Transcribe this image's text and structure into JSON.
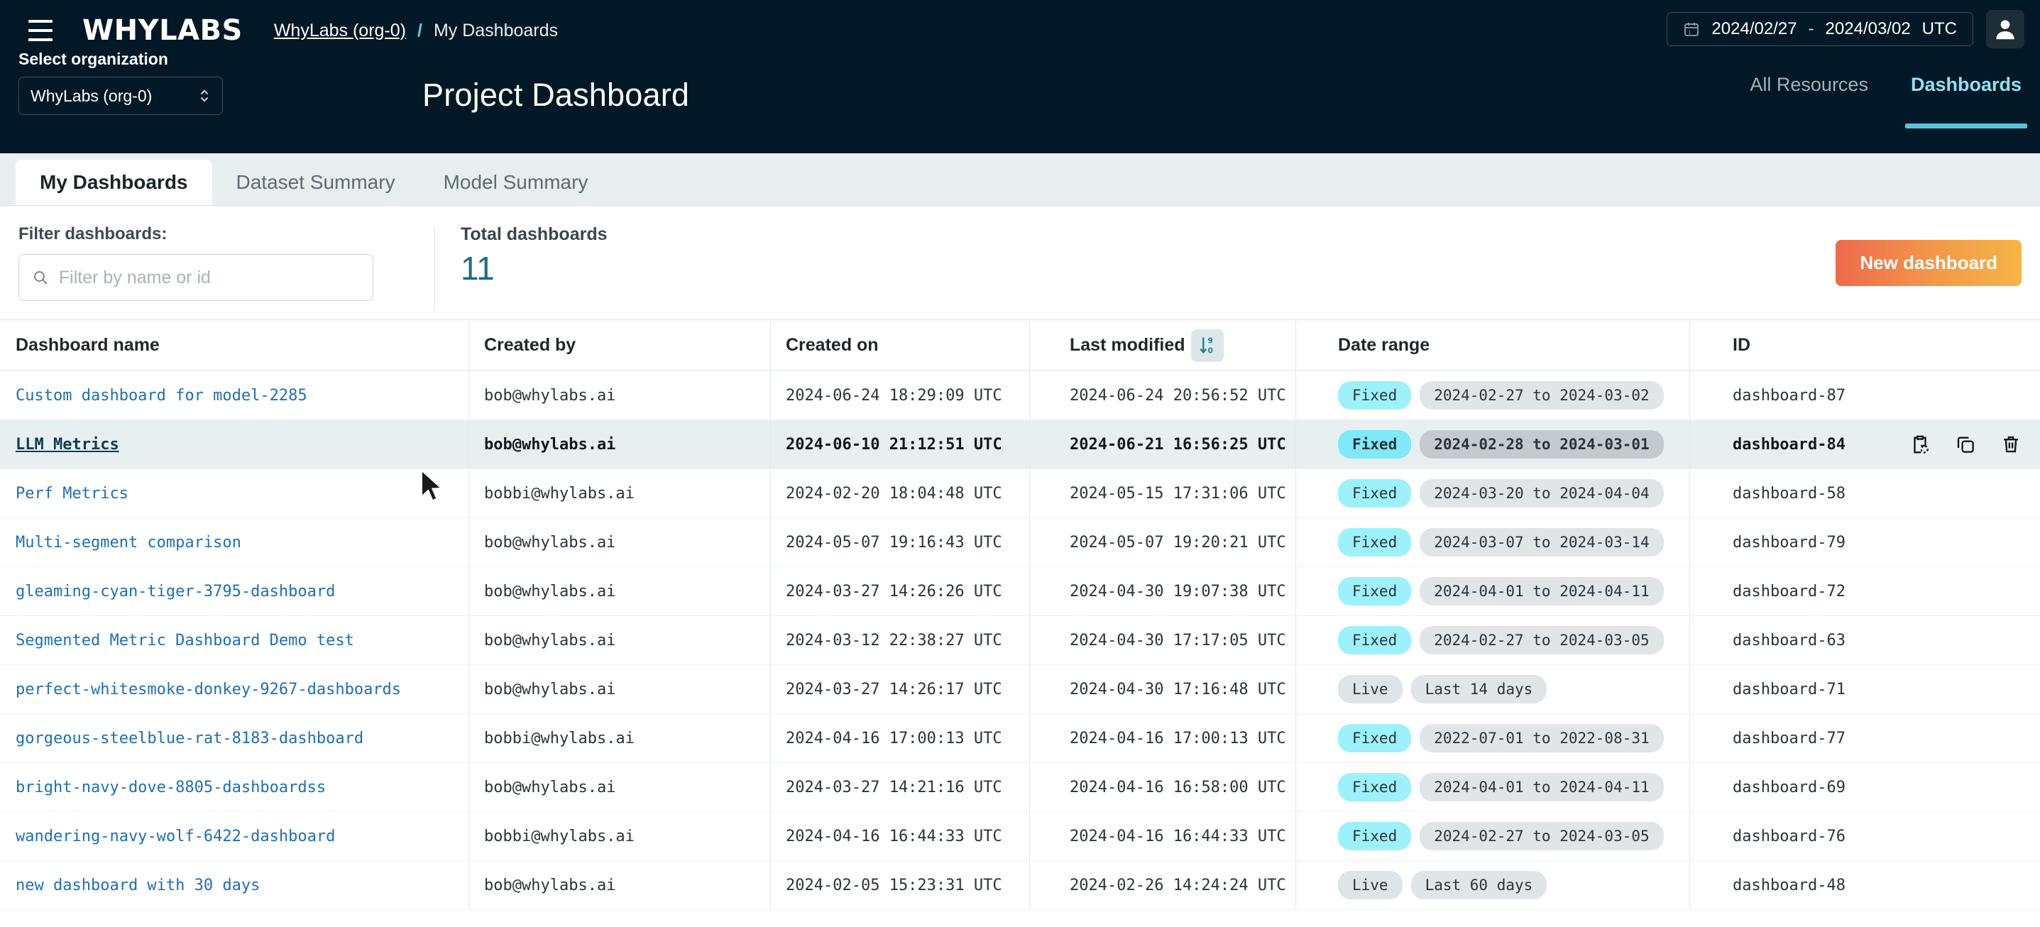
{
  "topbar": {
    "brand": "WHYLABS",
    "breadcrumb_org": "WhyLabs (org-0)",
    "breadcrumb_sep": "/",
    "breadcrumb_current": "My Dashboards",
    "date_start": "2024/02/27",
    "date_sep": "-",
    "date_end": "2024/03/02",
    "timezone": "UTC"
  },
  "subbar": {
    "org_label": "Select organization",
    "org_value": "WhyLabs (org-0)",
    "page_title": "Project Dashboard",
    "nav": [
      {
        "label": "All Resources",
        "active": false
      },
      {
        "label": "Dashboards",
        "active": true
      }
    ]
  },
  "tabs": [
    {
      "label": "My Dashboards",
      "active": true
    },
    {
      "label": "Dataset Summary",
      "active": false
    },
    {
      "label": "Model Summary",
      "active": false
    }
  ],
  "filter": {
    "label": "Filter dashboards:",
    "placeholder": "Filter by name or id",
    "value": "",
    "total_label": "Total dashboards",
    "total_value": "11",
    "new_dashboard_label": "New dashboard"
  },
  "table": {
    "columns": [
      "Dashboard name",
      "Created by",
      "Created on",
      "Last modified",
      "Date range",
      "ID"
    ],
    "sorted_column": "Last modified",
    "sort_direction": "descending",
    "rows": [
      {
        "name": "Custom dashboard for model-2285",
        "created_by": "bob@whylabs.ai",
        "created_on": "2024-06-24 18:29:09 UTC",
        "last_modified": "2024-06-24 20:56:52 UTC",
        "range_type": "Fixed",
        "range_value": "2024-02-27 to 2024-03-02",
        "id": "dashboard-87",
        "highlighted": false
      },
      {
        "name": "LLM Metrics",
        "created_by": "bob@whylabs.ai",
        "created_on": "2024-06-10 21:12:51 UTC",
        "last_modified": "2024-06-21 16:56:25 UTC",
        "range_type": "Fixed",
        "range_value": "2024-02-28 to 2024-03-01",
        "id": "dashboard-84",
        "highlighted": true
      },
      {
        "name": "Perf Metrics",
        "created_by": "bobbi@whylabs.ai",
        "created_on": "2024-02-20 18:04:48 UTC",
        "last_modified": "2024-05-15 17:31:06 UTC",
        "range_type": "Fixed",
        "range_value": "2024-03-20 to 2024-04-04",
        "id": "dashboard-58",
        "highlighted": false
      },
      {
        "name": "Multi-segment comparison",
        "created_by": "bob@whylabs.ai",
        "created_on": "2024-05-07 19:16:43 UTC",
        "last_modified": "2024-05-07 19:20:21 UTC",
        "range_type": "Fixed",
        "range_value": "2024-03-07 to 2024-03-14",
        "id": "dashboard-79",
        "highlighted": false
      },
      {
        "name": "gleaming-cyan-tiger-3795-dashboard",
        "created_by": "bob@whylabs.ai",
        "created_on": "2024-03-27 14:26:26 UTC",
        "last_modified": "2024-04-30 19:07:38 UTC",
        "range_type": "Fixed",
        "range_value": "2024-04-01 to 2024-04-11",
        "id": "dashboard-72",
        "highlighted": false
      },
      {
        "name": "Segmented Metric Dashboard Demo test",
        "created_by": "bob@whylabs.ai",
        "created_on": "2024-03-12 22:38:27 UTC",
        "last_modified": "2024-04-30 17:17:05 UTC",
        "range_type": "Fixed",
        "range_value": "2024-02-27 to 2024-03-05",
        "id": "dashboard-63",
        "highlighted": false
      },
      {
        "name": "perfect-whitesmoke-donkey-9267-dashboards",
        "created_by": "bob@whylabs.ai",
        "created_on": "2024-03-27 14:26:17 UTC",
        "last_modified": "2024-04-30 17:16:48 UTC",
        "range_type": "Live",
        "range_value": "Last 14 days",
        "id": "dashboard-71",
        "highlighted": false
      },
      {
        "name": "gorgeous-steelblue-rat-8183-dashboard",
        "created_by": "bobbi@whylabs.ai",
        "created_on": "2024-04-16 17:00:13 UTC",
        "last_modified": "2024-04-16 17:00:13 UTC",
        "range_type": "Fixed",
        "range_value": "2022-07-01 to 2022-08-31",
        "id": "dashboard-77",
        "highlighted": false
      },
      {
        "name": "bright-navy-dove-8805-dashboardss",
        "created_by": "bob@whylabs.ai",
        "created_on": "2024-03-27 14:21:16 UTC",
        "last_modified": "2024-04-16 16:58:00 UTC",
        "range_type": "Fixed",
        "range_value": "2024-04-01 to 2024-04-11",
        "id": "dashboard-69",
        "highlighted": false
      },
      {
        "name": "wandering-navy-wolf-6422-dashboard",
        "created_by": "bobbi@whylabs.ai",
        "created_on": "2024-04-16 16:44:33 UTC",
        "last_modified": "2024-04-16 16:44:33 UTC",
        "range_type": "Fixed",
        "range_value": "2024-02-27 to 2024-03-05",
        "id": "dashboard-76",
        "highlighted": false
      },
      {
        "name": "new dashboard with 30 days",
        "created_by": "bob@whylabs.ai",
        "created_on": "2024-02-05 15:23:31 UTC",
        "last_modified": "2024-02-26 14:24:24 UTC",
        "range_type": "Live",
        "range_value": "Last 60 days",
        "id": "dashboard-48",
        "highlighted": false
      }
    ],
    "row_actions": [
      {
        "name": "copy-id-icon",
        "label": "Copy ID"
      },
      {
        "name": "duplicate-icon",
        "label": "Duplicate"
      },
      {
        "name": "delete-icon",
        "label": "Delete"
      }
    ]
  },
  "colors": {
    "nav_bg": "#021826",
    "accent_cyan": "#57c4dd",
    "link_blue": "#1d6fb4",
    "total_teal": "#176d85",
    "badge_fixed": "#9df1fb",
    "badge_live": "#dce5e8",
    "new_button_from": "#ed6a4c",
    "new_button_to": "#f5b545"
  }
}
